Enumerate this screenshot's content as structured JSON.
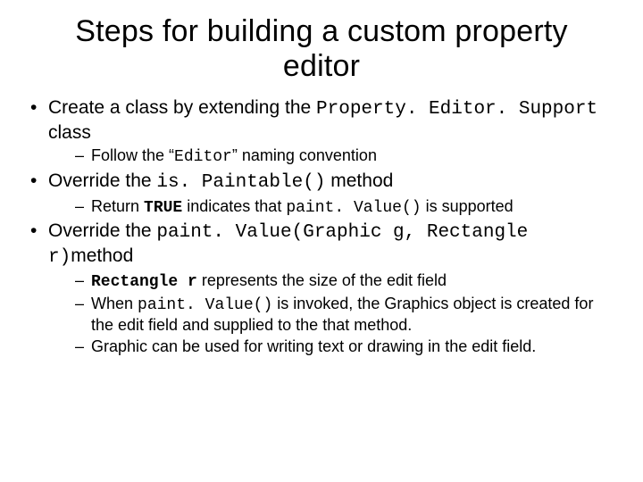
{
  "title": "Steps for building a custom property editor",
  "b1": {
    "pre": "Create a class by extending the ",
    "code": "Property. Editor. Support",
    "post": " class",
    "s1": {
      "pre": "Follow the “",
      "code": "Editor",
      "post": "” naming convention"
    }
  },
  "b2": {
    "pre": "Override the ",
    "code": "is. Paintable()",
    "post": " method",
    "s1": {
      "pre": "Return ",
      "bold": "TRUE",
      "mid": " indicates that ",
      "code": "paint. Value()",
      "post": " is supported"
    }
  },
  "b3": {
    "pre": "Override the ",
    "code": "paint. Value(Graphic g, Rectangle r)",
    "post": "method",
    "s1": {
      "code": "Rectangle r",
      "post": " represents the size of the edit field"
    },
    "s2": {
      "pre": "When ",
      "code": "paint. Value()",
      "post": " is invoked, the Graphics object is created for the edit field and supplied to the that method."
    },
    "s3": "Graphic can be used for writing text or drawing in the edit field."
  }
}
